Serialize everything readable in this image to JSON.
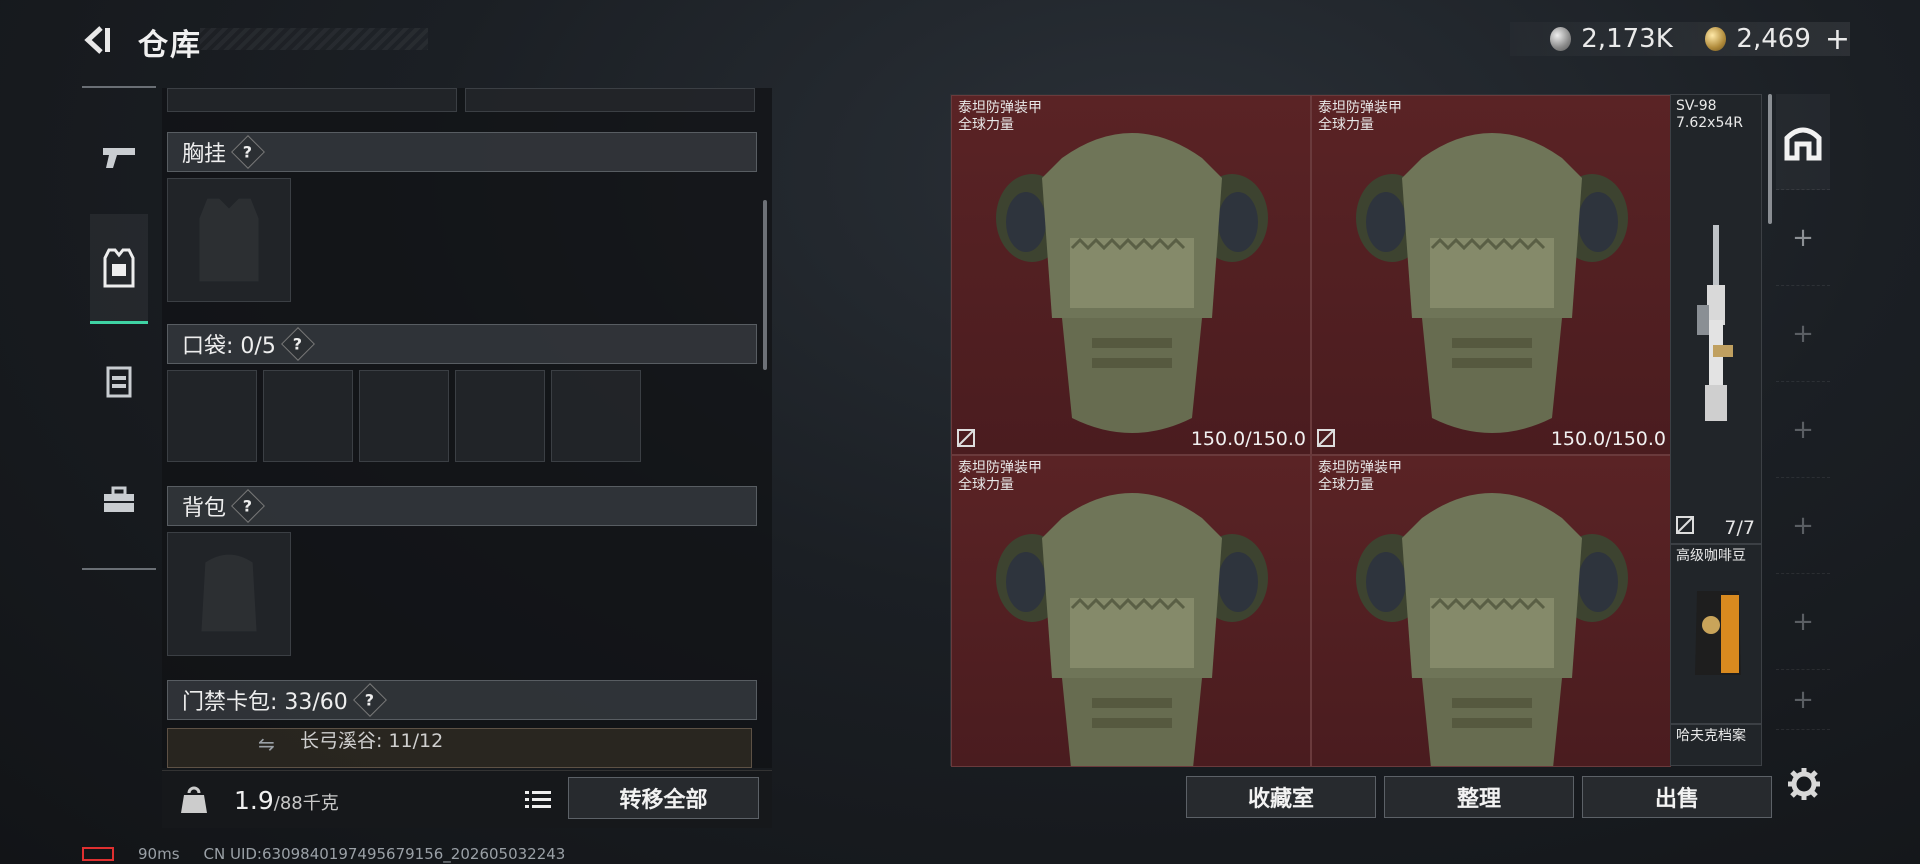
{
  "header": {
    "title": "仓库"
  },
  "currency": {
    "silver": "2,173K",
    "gold": "2,469",
    "add": "+"
  },
  "left_rail": {
    "items": [
      "gun-icon",
      "armor-vest-icon",
      "chest-rig-icon",
      "briefcase-icon"
    ],
    "active_index": 1
  },
  "sections": {
    "chest_rig": {
      "label": "胸挂"
    },
    "pockets": {
      "label": "口袋: 0/5"
    },
    "backpack": {
      "label": "背包"
    },
    "keycard": {
      "label": "门禁卡包: 33/60",
      "sub": "长弓溪谷: 11/12"
    }
  },
  "bottom": {
    "weight_value": "1.9",
    "weight_max": "/88千克",
    "transfer_all": "转移全部"
  },
  "status": {
    "ping": "90ms",
    "uid": "CN UID:6309840197495679156_202605032243"
  },
  "stash": {
    "armor_items": [
      {
        "name1": "泰坦防弹装甲",
        "name2": "全球力量",
        "durability": "150.0/150.0"
      },
      {
        "name1": "泰坦防弹装甲",
        "name2": "全球力量",
        "durability": "150.0/150.0"
      },
      {
        "name1": "泰坦防弹装甲",
        "name2": "全球力量",
        "durability": ""
      },
      {
        "name1": "泰坦防弹装甲",
        "name2": "全球力量",
        "durability": ""
      }
    ],
    "rifle": {
      "name": "SV-98",
      "ammo": "7.62x54R",
      "count": "7/7"
    },
    "coffee": {
      "name": "高级咖啡豆"
    },
    "archive": {
      "name": "哈夫克档案"
    }
  },
  "actions": {
    "collection": "收藏室",
    "sort": "整理",
    "sell": "出售"
  },
  "colors": {
    "accent": "#3fd3a4",
    "armor_bg": "#5a2325"
  }
}
